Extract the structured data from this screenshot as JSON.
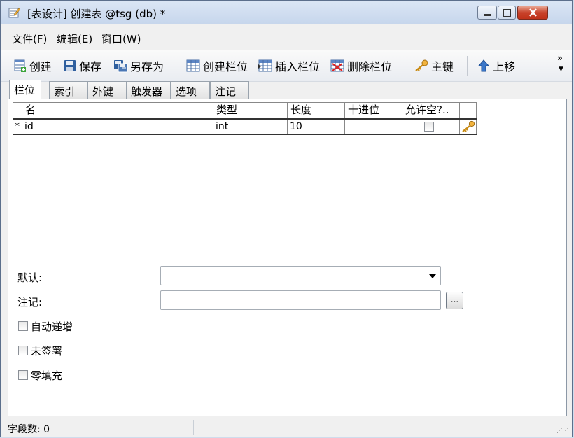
{
  "window": {
    "title": "[表设计] 创建表 @tsg (db) *"
  },
  "menu": [
    {
      "label": "文件(F)"
    },
    {
      "label": "编辑(E)"
    },
    {
      "label": "窗口(W)"
    }
  ],
  "toolbar": {
    "create": "创建",
    "save": "保存",
    "save_as": "另存为",
    "create_field": "创建栏位",
    "insert_field": "插入栏位",
    "delete_field": "删除栏位",
    "primary_key": "主键",
    "move_up": "上移",
    "overflow": "»"
  },
  "tabs": [
    {
      "label": "栏位",
      "active": true
    },
    {
      "label": "索引"
    },
    {
      "label": "外键"
    },
    {
      "label": "触发器"
    },
    {
      "label": "选项"
    },
    {
      "label": "注记"
    }
  ],
  "grid": {
    "columns": [
      "名",
      "类型",
      "长度",
      "十进位",
      "允许空?.."
    ],
    "rows": [
      {
        "marker": "*",
        "name": "id",
        "type": "int",
        "length": "10",
        "decimal": "",
        "nullable": false,
        "is_primary_key": true
      }
    ]
  },
  "properties": {
    "default_label": "默认:",
    "default_value": "",
    "comment_label": "注记:",
    "comment_value": "",
    "ellipsis": "...",
    "auto_increment": "自动递增",
    "unsigned": "未签署",
    "zerofill": "零填充"
  },
  "status": {
    "field_count": "字段数: 0"
  },
  "colors": {
    "title_bg": "#c6d6ec",
    "close_red": "#c8422b",
    "key_gold": "#d9a21b"
  }
}
